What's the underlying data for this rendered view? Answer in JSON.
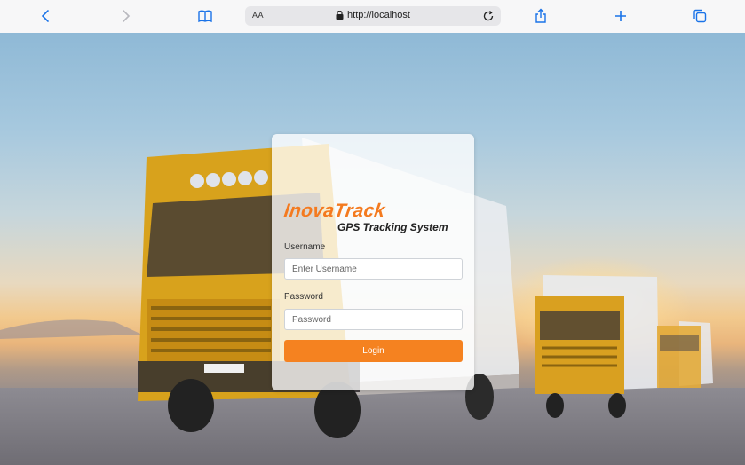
{
  "browser": {
    "text_size_label": "AA",
    "url": "http://localhost",
    "icons": [
      "back-chevron-icon",
      "forward-chevron-icon",
      "bookmarks-icon",
      "lock-icon",
      "reload-icon",
      "share-icon",
      "plus-icon",
      "tabs-icon"
    ]
  },
  "login": {
    "logo_text": "InovaTrack",
    "tagline": "GPS Tracking System",
    "username_label": "Username",
    "username_placeholder": "Enter Username",
    "password_label": "Password",
    "password_placeholder": "Password",
    "login_label": "Login"
  },
  "colors": {
    "accent": "#f58220",
    "browser_icon": "#1a73e8"
  }
}
